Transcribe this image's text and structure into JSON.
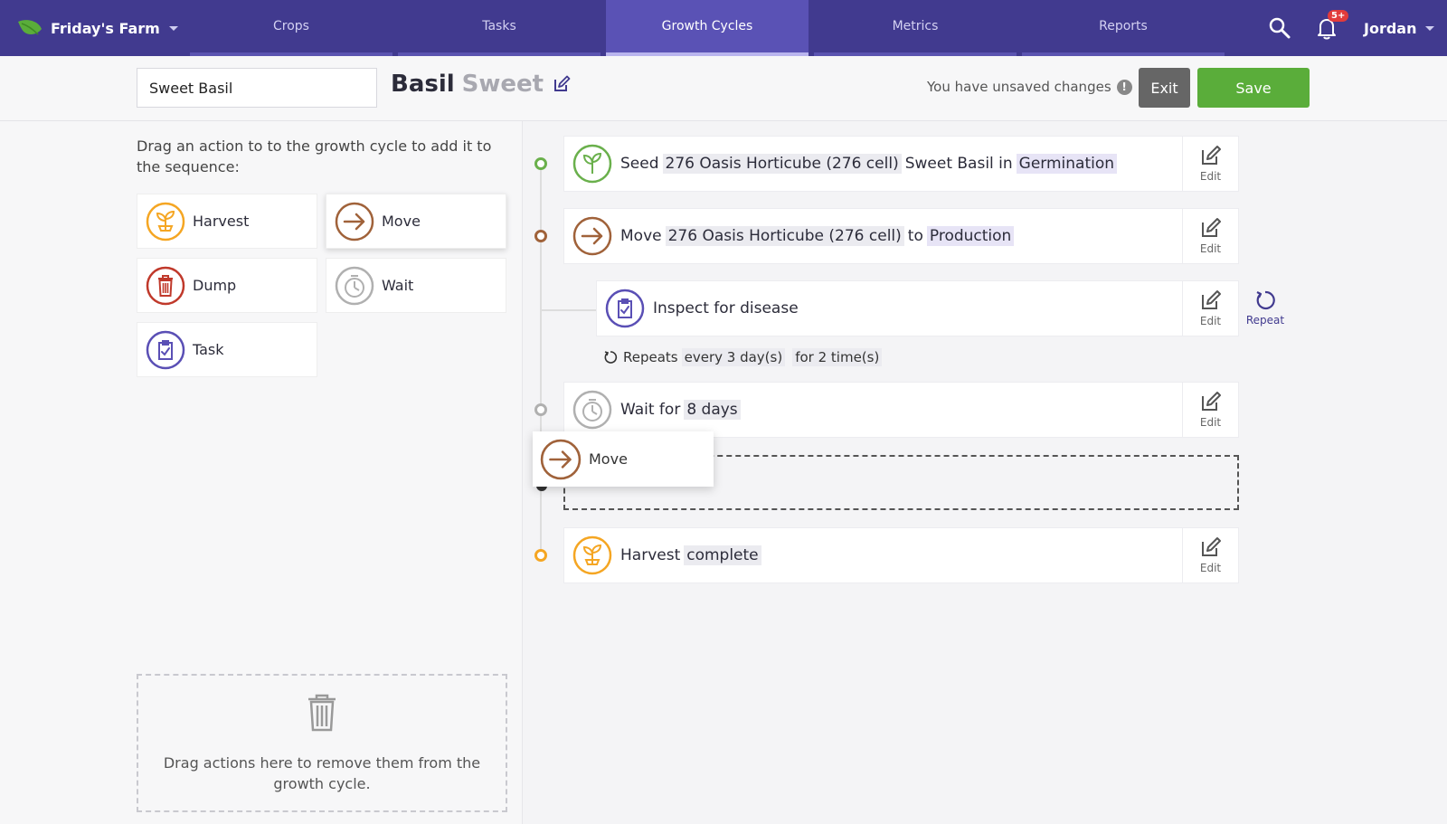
{
  "nav": {
    "farm_name": "Friday's Farm",
    "tabs": [
      {
        "label": "Crops"
      },
      {
        "label": "Tasks"
      },
      {
        "label": "Growth Cycles"
      },
      {
        "label": "Metrics"
      },
      {
        "label": "Reports"
      }
    ],
    "active_tab": "Growth Cycles",
    "notification_badge": "5+",
    "user_name": "Jordan"
  },
  "subheader": {
    "name_value": "Sweet Basil",
    "crop": "Basil",
    "variety": "Sweet",
    "unsaved_text": "You have unsaved changes",
    "warn_glyph": "!",
    "exit_label": "Exit",
    "save_label": "Save"
  },
  "palette": {
    "instruction": "Drag an action to to the growth cycle to add it to the sequence:",
    "items": [
      {
        "label": "Harvest",
        "icon": "sprout-icon",
        "color": "#f5a623"
      },
      {
        "label": "Move",
        "icon": "arrow-right-icon",
        "color": "#a0623a"
      },
      {
        "label": "Dump",
        "icon": "trash-icon",
        "color": "#c0392b"
      },
      {
        "label": "Wait",
        "icon": "timer-icon",
        "color": "#b0b0b0"
      },
      {
        "label": "Task",
        "icon": "clipboard-icon",
        "color": "#5a4fb5"
      }
    ],
    "trash_text": "Drag actions here to remove them from the growth cycle."
  },
  "timeline": {
    "steps": [
      {
        "verb": "Seed",
        "container": "276 Oasis Horticube (276 cell)",
        "middle": "Sweet Basil in",
        "location": "Germination",
        "edit_label": "Edit"
      },
      {
        "verb": "Move",
        "container": "276 Oasis Horticube (276 cell)",
        "middle": "to",
        "location": "Production",
        "edit_label": "Edit"
      },
      {
        "verb": "Inspect for disease",
        "edit_label": "Edit",
        "repeat_label": "Repeat"
      },
      {
        "verb": "Wait for",
        "duration": "8 days",
        "edit_label": "Edit"
      },
      {
        "verb": "Harvest",
        "status": "complete",
        "edit_label": "Edit"
      }
    ],
    "repeats": {
      "label": "Repeats",
      "interval": "every 3 day(s)",
      "count": "for 2 time(s)"
    },
    "dragging_label": "Move"
  },
  "colors": {
    "nav_bg": "#413a8f",
    "nav_active": "#5a52b5",
    "save_green": "#5aad3a",
    "seed_green": "#6ab04c",
    "move_brown": "#a0623a",
    "task_purple": "#5a4fb5",
    "harvest_orange": "#f5a623",
    "dump_red": "#c0392b",
    "wait_gray": "#b0b0b0"
  }
}
